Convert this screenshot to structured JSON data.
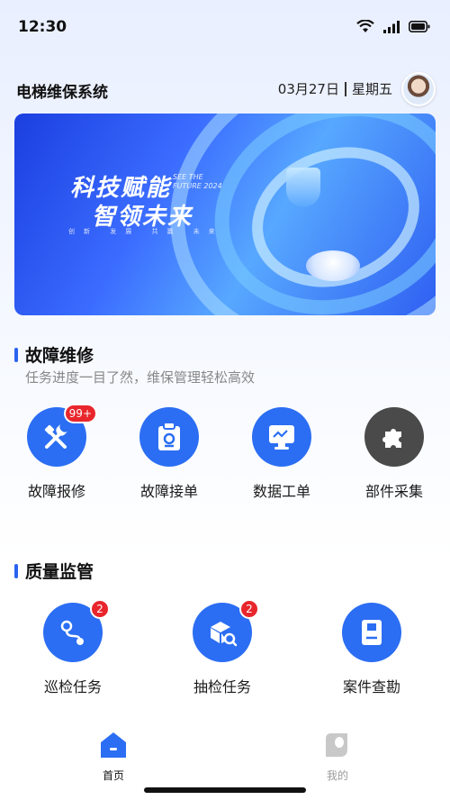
{
  "status_bar": {
    "time": "12:30"
  },
  "header": {
    "title": "电梯维保系统",
    "date": "03月27日",
    "weekday": "星期五"
  },
  "banner": {
    "title_line1": "科技赋能",
    "title_line2": "智领未来",
    "en_line1": "SEE THE",
    "en_line2": "FUTURE 2024",
    "small_text": "创新 发展 共赢 未来"
  },
  "fault_section": {
    "title": "故障维修",
    "subtitle": "任务进度一目了然，维保管理轻松高效",
    "items": [
      {
        "label": "故障报修",
        "icon": "repair-tools-icon",
        "badge": "99+"
      },
      {
        "label": "故障接单",
        "icon": "clipboard-order-icon",
        "badge": ""
      },
      {
        "label": "数据工单",
        "icon": "monitor-chart-icon",
        "badge": ""
      },
      {
        "label": "部件采集",
        "icon": "puzzle-parts-icon",
        "badge": ""
      }
    ]
  },
  "quality_section": {
    "title": "质量监管",
    "items": [
      {
        "label": "巡检任务",
        "icon": "route-inspection-icon",
        "badge": "2"
      },
      {
        "label": "抽检任务",
        "icon": "box-search-icon",
        "badge": "2"
      },
      {
        "label": "案件查勘",
        "icon": "case-book-icon",
        "badge": ""
      }
    ]
  },
  "tabbar": {
    "home_label": "首页",
    "mine_label": "我的",
    "active_color": "#2b6ef3",
    "inactive_color": "#b5b5b5"
  }
}
